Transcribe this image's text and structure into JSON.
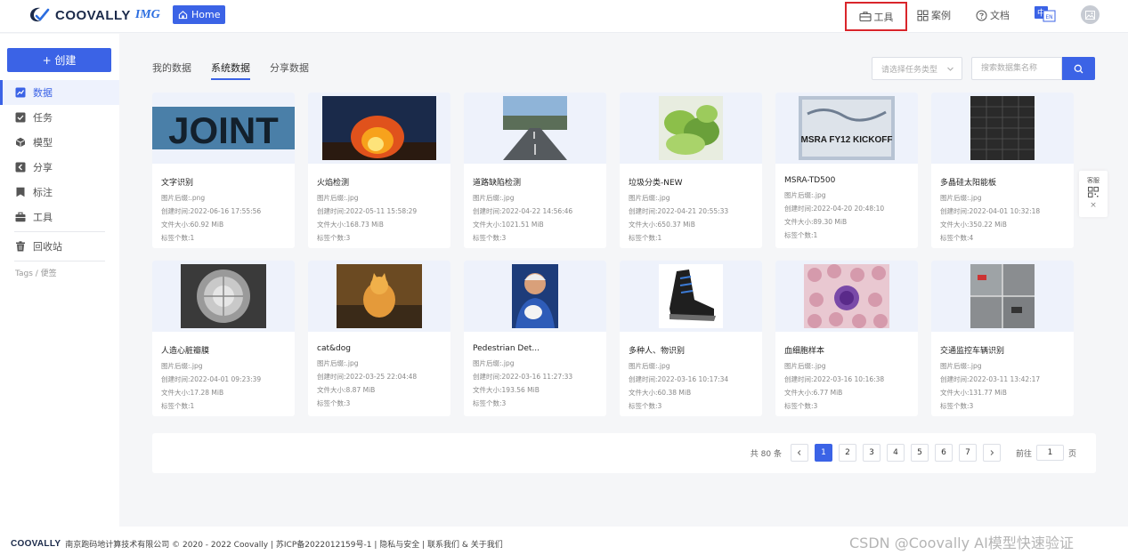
{
  "header": {
    "logo_text": "COOVALLY",
    "logo_suffix": "IMG",
    "home_label": "Home",
    "nav": [
      {
        "label": "工具",
        "icon": "toolbox-icon"
      },
      {
        "label": "案例",
        "icon": "grid-icon"
      },
      {
        "label": "文档",
        "icon": "help-icon"
      }
    ],
    "lang_icon": "language-switch-icon",
    "avatar_icon": "avatar-image-icon"
  },
  "sidebar": {
    "create_label": "+ 创建",
    "items": [
      {
        "label": "数据",
        "icon": "chart-icon",
        "active": true
      },
      {
        "label": "任务",
        "icon": "check-icon"
      },
      {
        "label": "模型",
        "icon": "cube-icon"
      },
      {
        "label": "分享",
        "icon": "share-icon"
      },
      {
        "label": "标注",
        "icon": "bookmark-icon"
      },
      {
        "label": "工具",
        "icon": "toolbox-icon"
      },
      {
        "label": "回收站",
        "icon": "trash-icon"
      }
    ],
    "tags_label": "Tags / 便签"
  },
  "tabs": [
    "我的数据",
    "系统数据",
    "分享数据"
  ],
  "active_tab": 1,
  "filters": {
    "task_type_placeholder": "请选择任务类型",
    "search_placeholder": "搜索数据集名称"
  },
  "meta_labels": {
    "ext": "图片后缀:",
    "created": "创建时间:",
    "size": "文件大小:",
    "labels": "标签个数:"
  },
  "datasets": [
    {
      "title": "文字识别",
      "ext": ".png",
      "created": "2022-06-16 17:55:56",
      "size": "60.92 MiB",
      "labels": "1",
      "thumb": "joint"
    },
    {
      "title": "火焰检测",
      "ext": ".jpg",
      "created": "2022-05-11 15:58:29",
      "size": "168.73 MiB",
      "labels": "3",
      "thumb": "fire"
    },
    {
      "title": "道路缺陷检测",
      "ext": ".jpg",
      "created": "2022-04-22 14:56:46",
      "size": "1021.51 MiB",
      "labels": "3",
      "thumb": "road"
    },
    {
      "title": "垃圾分类-NEW",
      "ext": ".jpg",
      "created": "2022-04-21 20:55:33",
      "size": "650.37 MiB",
      "labels": "1",
      "thumb": "greens"
    },
    {
      "title": "MSRA-TD500",
      "ext": ".jpg",
      "created": "2022-04-20 20:48:10",
      "size": "89.30 MiB",
      "labels": "1",
      "thumb": "msra"
    },
    {
      "title": "多晶硅太阳能板",
      "ext": ".jpg",
      "created": "2022-04-01 10:32:18",
      "size": "350.22 MiB",
      "labels": "4",
      "thumb": "solar"
    },
    {
      "title": "人造心脏瓣膜",
      "ext": ".jpg",
      "created": "2022-04-01 09:23:39",
      "size": "17.28 MiB",
      "labels": "1",
      "thumb": "valve"
    },
    {
      "title": "cat&dog",
      "ext": ".jpg",
      "created": "2022-03-25 22:04:48",
      "size": "8.87 MiB",
      "labels": "3",
      "thumb": "cat"
    },
    {
      "title": "Pedestrian Det...",
      "ext": ".jpg",
      "created": "2022-03-16 11:27:33",
      "size": "193.56 MiB",
      "labels": "3",
      "thumb": "person"
    },
    {
      "title": "多种人、物识别",
      "ext": ".jpg",
      "created": "2022-03-16 10:17:34",
      "size": "60.38 MiB",
      "labels": "3",
      "thumb": "shoe"
    },
    {
      "title": "血细胞样本",
      "ext": ".jpg",
      "created": "2022-03-16 10:16:38",
      "size": "6.77 MiB",
      "labels": "3",
      "thumb": "cells"
    },
    {
      "title": "交通监控车辆识别",
      "ext": ".jpg",
      "created": "2022-03-11 13:42:17",
      "size": "131.77 MiB",
      "labels": "3",
      "thumb": "traffic"
    }
  ],
  "thumb_texts": {
    "joint": "JOINT",
    "msra": "MSRA FY12 KICKOFF"
  },
  "float_panel": {
    "label": "客服",
    "close": "×"
  },
  "pagination": {
    "total": "共 80 条",
    "pages": [
      "1",
      "2",
      "3",
      "4",
      "5",
      "6",
      "7"
    ],
    "current": "1",
    "goto_label": "前往",
    "goto_value": "1",
    "page_suffix": "页"
  },
  "footer": {
    "logo": "COOVALLY",
    "text": "南京跑码地计算技术有限公司 © 2020 - 2022 Coovally | 苏ICP备2022012159号-1 | 隐私与安全 | 联系我们 & 关于我们"
  },
  "watermark": "CSDN @Coovally   AI模型快速验证"
}
